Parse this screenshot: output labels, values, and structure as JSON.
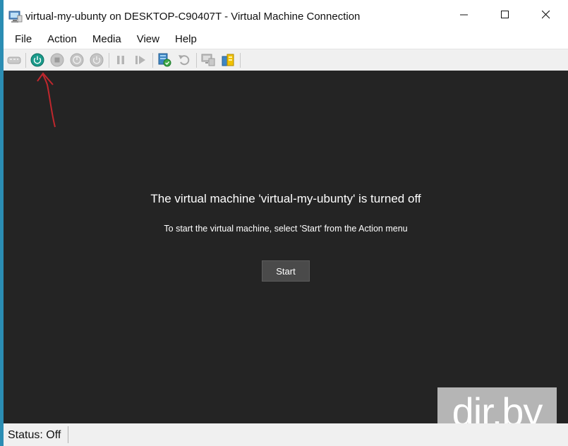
{
  "window": {
    "title": "virtual-my-ubunty on DESKTOP-C90407T - Virtual Machine Connection",
    "controls": {
      "minimize": "—",
      "maximize": "☐",
      "close": "✕"
    }
  },
  "menu": {
    "items": [
      {
        "label": "File"
      },
      {
        "label": "Action"
      },
      {
        "label": "Media"
      },
      {
        "label": "View"
      },
      {
        "label": "Help"
      }
    ]
  },
  "toolbar": {
    "buttons": [
      {
        "icon": "ctrl-alt-del-icon",
        "enabled": false
      },
      {
        "icon": "start-icon",
        "enabled": true,
        "color": "#1a9a8a"
      },
      {
        "icon": "turn-off-icon",
        "enabled": false
      },
      {
        "icon": "shut-down-icon",
        "enabled": false
      },
      {
        "icon": "save-icon",
        "enabled": false
      },
      {
        "icon": "pause-icon",
        "enabled": false
      },
      {
        "icon": "resume-icon",
        "enabled": false
      },
      {
        "icon": "checkpoint-icon",
        "enabled": true
      },
      {
        "icon": "revert-icon",
        "enabled": false
      },
      {
        "icon": "enhanced-session-icon",
        "enabled": false
      },
      {
        "icon": "share-icon",
        "enabled": true
      }
    ]
  },
  "screen": {
    "title": "The virtual machine 'virtual-my-ubunty' is turned off",
    "subtitle": "To start the virtual machine, select 'Start' from the Action menu",
    "start_button": "Start",
    "background": "#242424",
    "annotation_color": "#c0272d"
  },
  "watermark": {
    "text": "dir.by"
  },
  "status": {
    "text": "Status: Off"
  }
}
